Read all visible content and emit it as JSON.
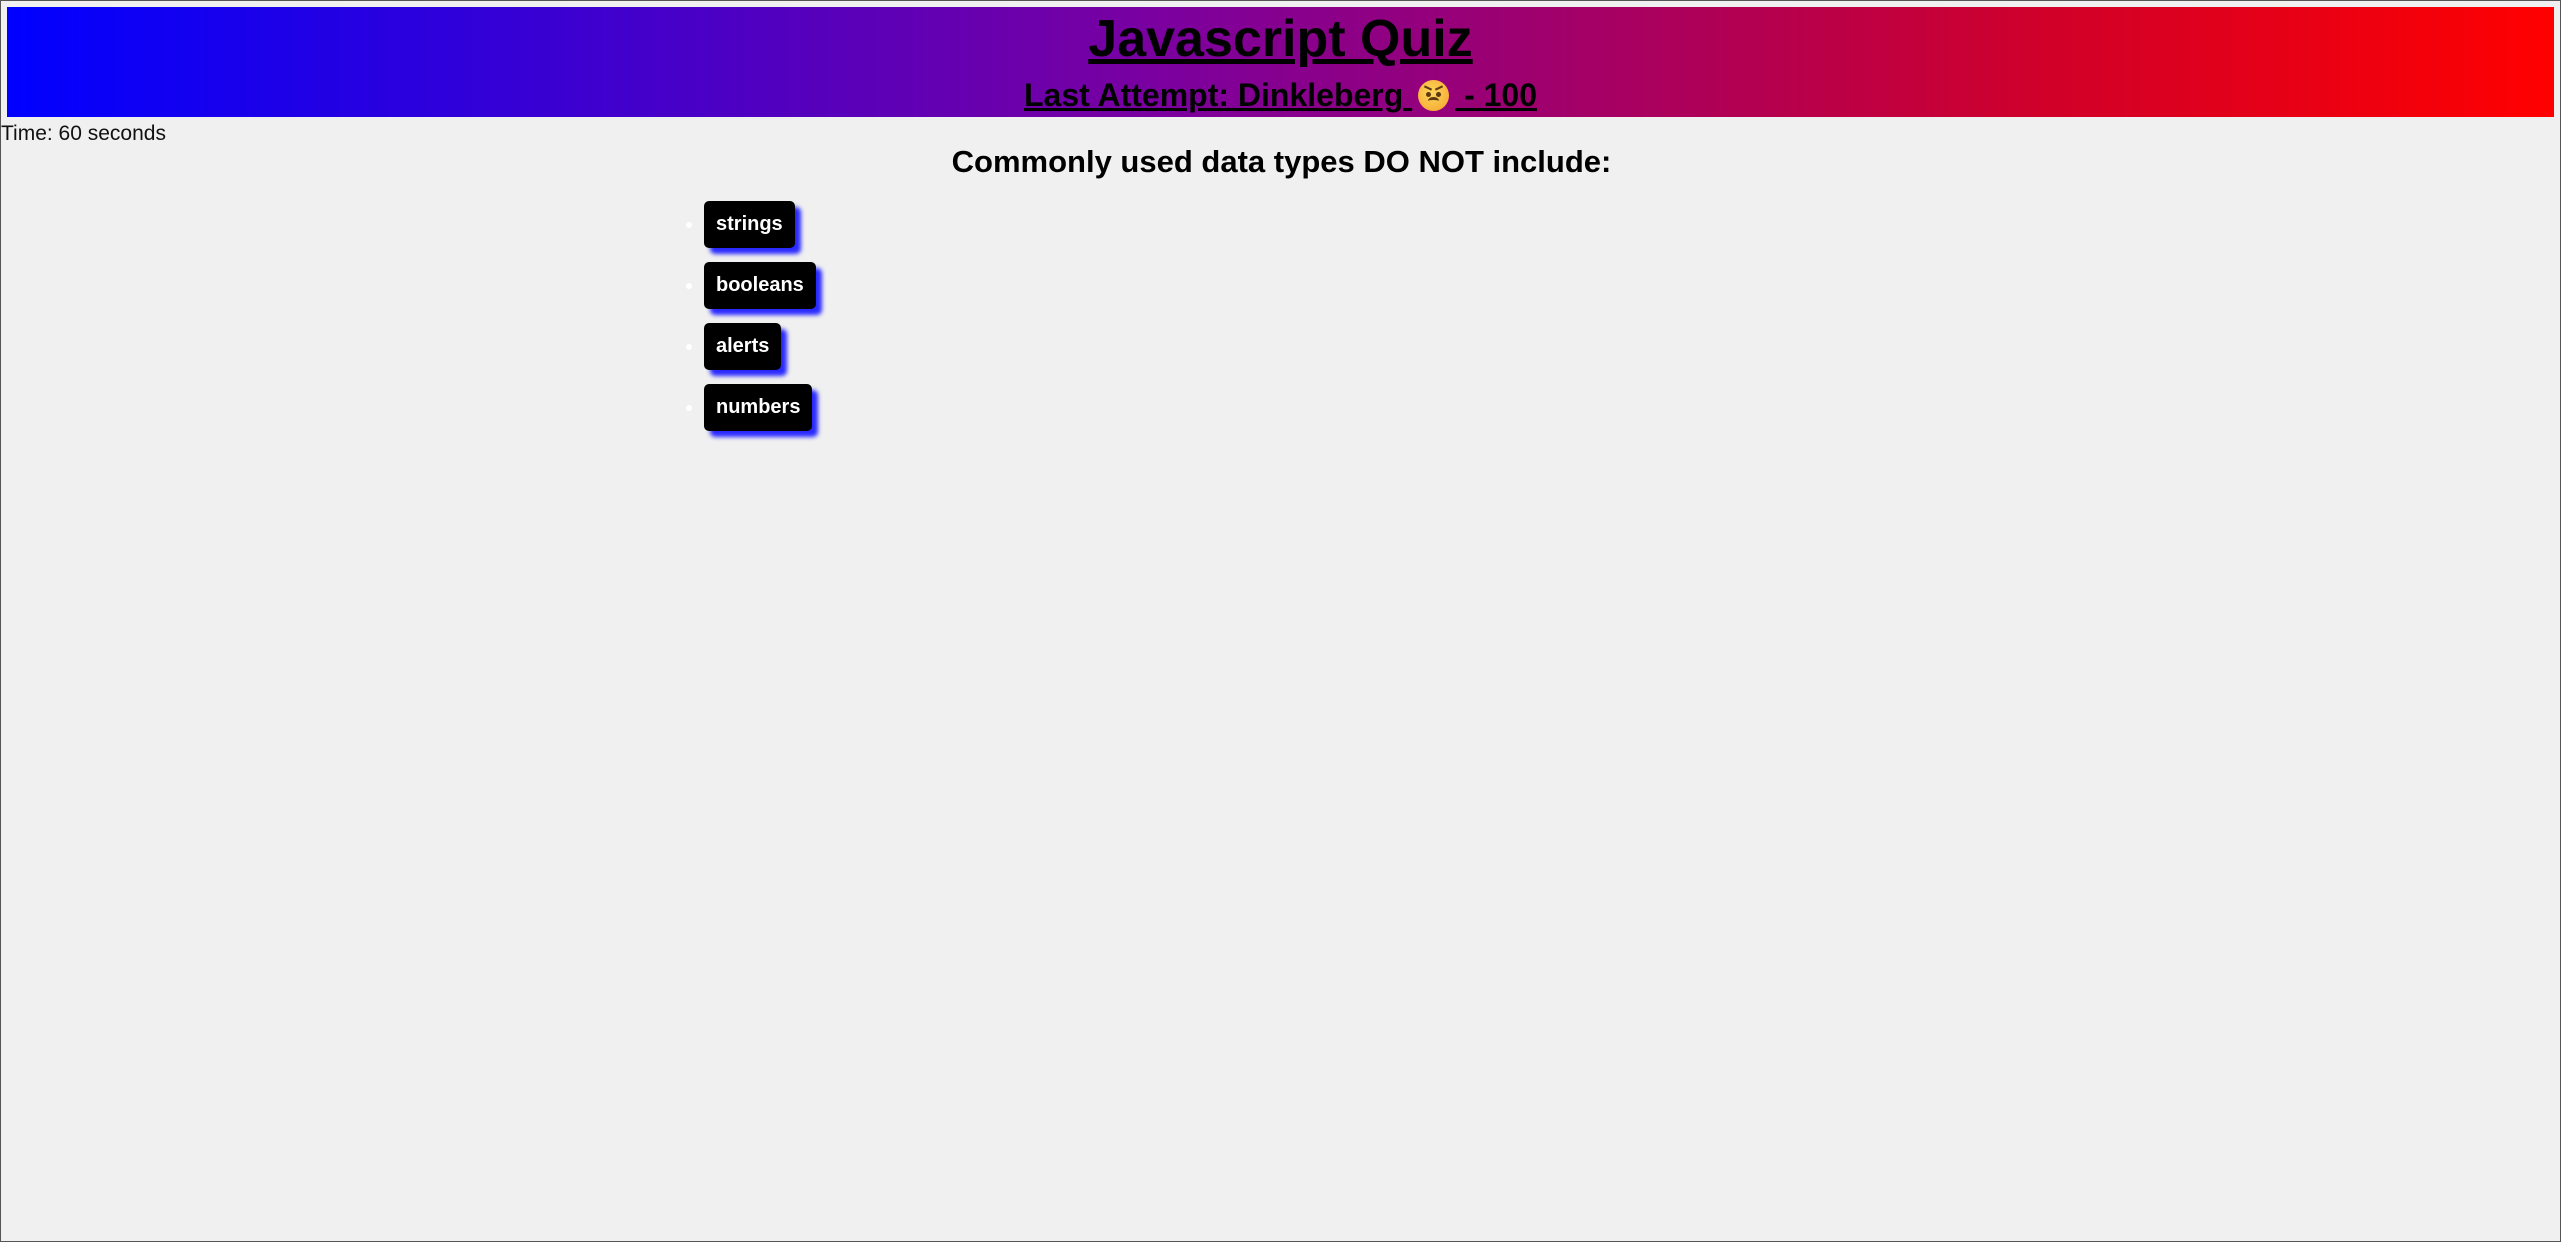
{
  "header": {
    "title": "Javascript Quiz",
    "last_attempt_prefix": "Last Attempt: Dinkleberg",
    "last_attempt_emoji": "angry-face",
    "last_attempt_suffix": "- 100"
  },
  "timer": {
    "text": "Time: 60 seconds"
  },
  "question": {
    "text": "Commonly used data types DO NOT include:"
  },
  "answers": [
    {
      "label": "strings"
    },
    {
      "label": "booleans"
    },
    {
      "label": "alerts"
    },
    {
      "label": "numbers"
    }
  ],
  "colors": {
    "gradient_start": "#0000ff",
    "gradient_end": "#ff0000",
    "button_bg": "#000000",
    "button_shadow": "#2a2aff",
    "page_bg": "#f0f0f0"
  }
}
